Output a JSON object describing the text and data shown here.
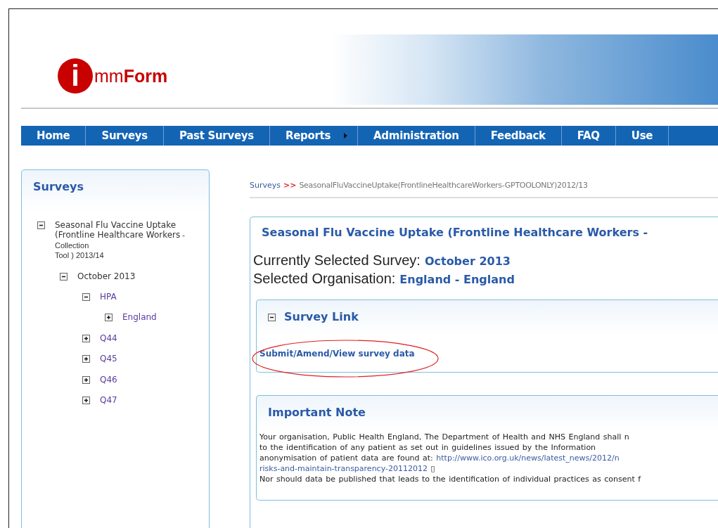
{
  "logo": {
    "initial": "i",
    "rest_light": "mm",
    "rest_bold": "Form"
  },
  "nav": [
    {
      "label": "Home",
      "has_submenu": false
    },
    {
      "label": "Surveys",
      "has_submenu": false
    },
    {
      "label": "Past Surveys",
      "has_submenu": false
    },
    {
      "label": "Reports",
      "has_submenu": true
    },
    {
      "label": "Administration",
      "has_submenu": false
    },
    {
      "label": "Feedback",
      "has_submenu": false
    },
    {
      "label": "FAQ",
      "has_submenu": false
    },
    {
      "label": "Use",
      "has_submenu": false
    }
  ],
  "sidebar": {
    "title": "Surveys",
    "tree": [
      {
        "label": "Seasonal Flu Vaccine Uptake (Frontline Healthcare Workers",
        "label_tail": " - Collection",
        "label_end": "Tool ) 2013/14",
        "expanded": true,
        "children": [
          {
            "label": "October 2013",
            "expanded": true,
            "children": [
              {
                "label": "HPA",
                "expanded": true,
                "children": [
                  {
                    "label": "England",
                    "expanded": false
                  }
                ]
              },
              {
                "label": "Q44",
                "expanded": false
              },
              {
                "label": "Q45",
                "expanded": false
              },
              {
                "label": "Q46",
                "expanded": false
              },
              {
                "label": "Q47",
                "expanded": false
              }
            ]
          }
        ]
      }
    ]
  },
  "breadcrumb": {
    "root": "Surveys",
    "separator": ">>",
    "current": "SeasonalFluVaccineUptake(FrontlineHealthcareWorkers-GPTOOLONLY)2012/13"
  },
  "survey": {
    "title": "Seasonal Flu Vaccine Uptake (Frontline Healthcare Workers -",
    "fields": [
      {
        "label": "Currently Selected Survey:",
        "value": "October 2013"
      },
      {
        "label": "Selected Organisation:",
        "value": "England - England"
      }
    ]
  },
  "survey_link": {
    "title": "Survey Link",
    "expanded": true,
    "link": "Submit/Amend/View survey data",
    "highlighted": true
  },
  "note": {
    "title": "Important Note",
    "lines": [
      {
        "text": "Your organisation, Public Health England, The Department of Health and NHS England shall n"
      },
      {
        "text": "to the identification of any patient as set out in guidelines issued by the Information"
      },
      {
        "text": "anonymisation of patient data are found at: ",
        "link": "http://www.ico.org.uk/news/latest_news/2012/n"
      },
      {
        "link": "risks-and-maintain-transparency-20112012",
        "text": " ▯"
      },
      {
        "text": "Nor should data be published that leads to the identification of individual practices as consent f"
      }
    ]
  }
}
